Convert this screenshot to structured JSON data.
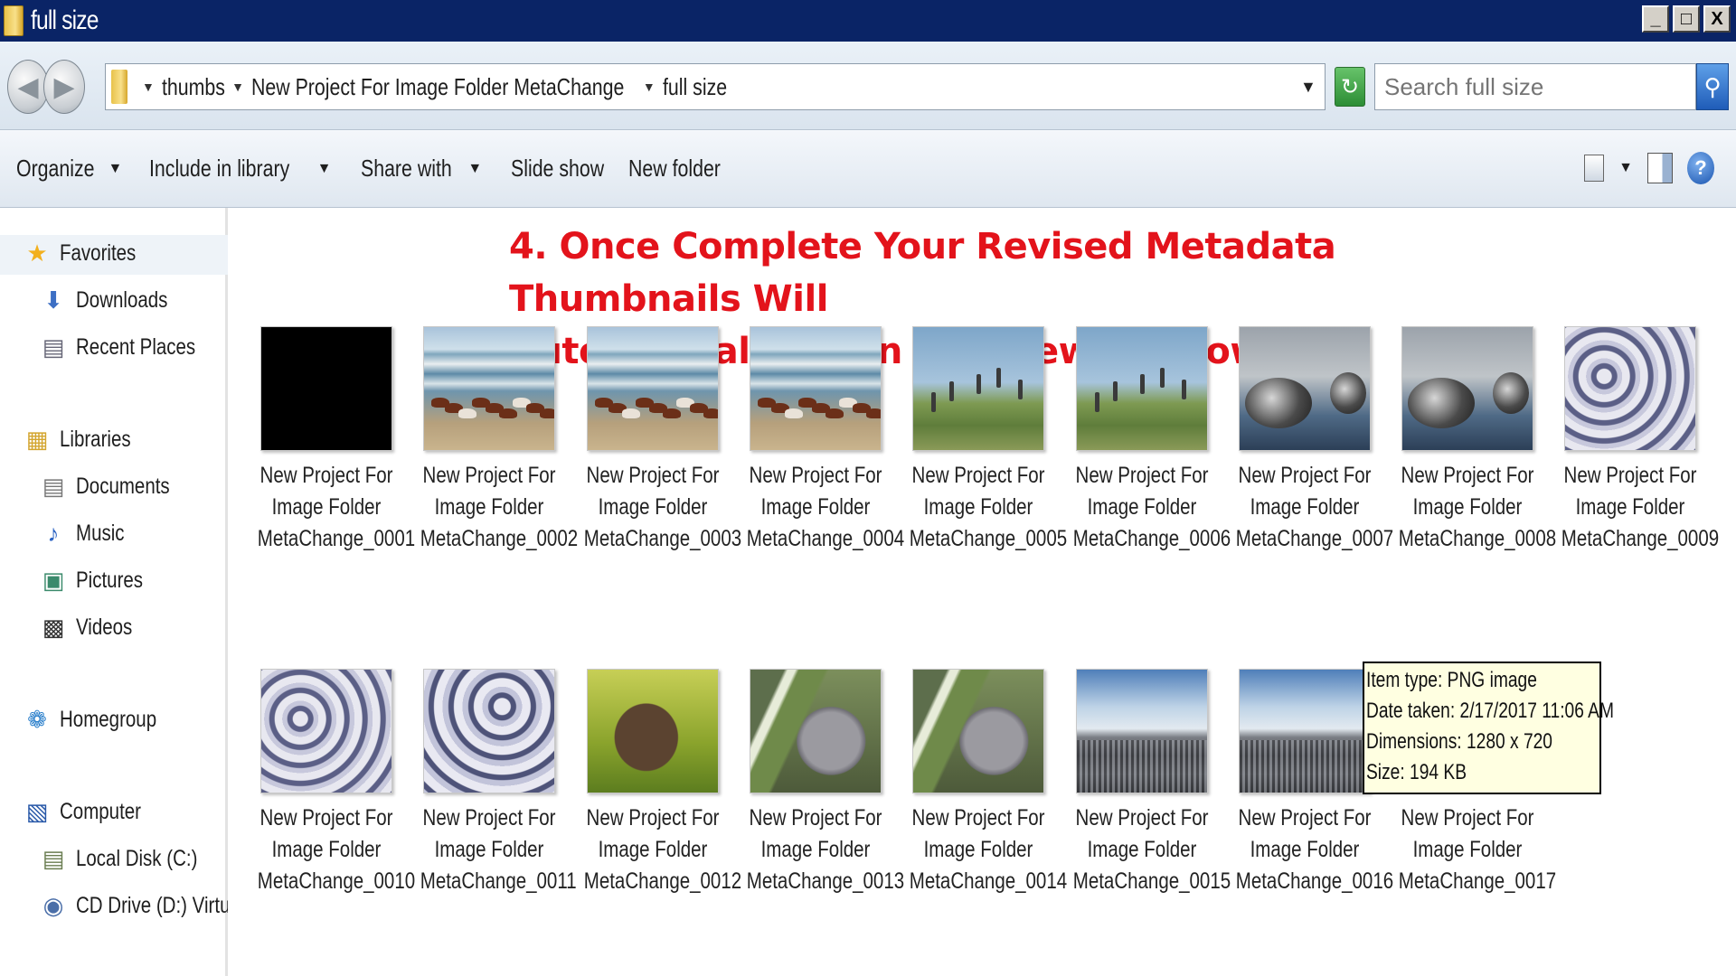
{
  "window": {
    "title": "full size",
    "controls": [
      "_",
      "□",
      "X"
    ]
  },
  "address": {
    "breadcrumbs": [
      "thumbs",
      "New Project For Image Folder MetaChange",
      "full size"
    ],
    "search_placeholder": "Search full size"
  },
  "toolbar": {
    "organize": "Organize",
    "include_in_library": "Include in library",
    "share_with": "Share with",
    "slide_show": "Slide show",
    "new_folder": "New folder"
  },
  "sidebar": {
    "favorites": "Favorites",
    "downloads": "Downloads",
    "recent_places": "Recent Places",
    "libraries": "Libraries",
    "documents": "Documents",
    "music": "Music",
    "pictures": "Pictures",
    "videos": "Videos",
    "homegroup": "Homegroup",
    "computer": "Computer",
    "local_disk": "Local Disk (C:)",
    "cd_drive": "CD Drive (D:) VirtualBo"
  },
  "annotation": {
    "line1": "4. Once Complete Your Revised Metadata Thumbnails Will",
    "line2": "Automatically Open In A New Window"
  },
  "caption_prefix": {
    "line1": "New Project For",
    "line2": "Image Folder"
  },
  "files": [
    {
      "line3": "MetaChange_0001",
      "art": "black"
    },
    {
      "line3": "MetaChange_0002",
      "art": "horse"
    },
    {
      "line3": "MetaChange_0003",
      "art": "horse"
    },
    {
      "line3": "MetaChange_0004",
      "art": "horse"
    },
    {
      "line3": "MetaChange_0005",
      "art": "birds"
    },
    {
      "line3": "MetaChange_0006",
      "art": "birds"
    },
    {
      "line3": "MetaChange_0007",
      "art": "seal"
    },
    {
      "line3": "MetaChange_0008",
      "art": "seal"
    },
    {
      "line3": "MetaChange_0009",
      "art": "flock"
    },
    {
      "line3": "MetaChange_0010",
      "art": "flock"
    },
    {
      "line3": "MetaChange_0011",
      "art": "flock2"
    },
    {
      "line3": "MetaChange_0012",
      "art": "hyrax"
    },
    {
      "line3": "MetaChange_0013",
      "art": "koala"
    },
    {
      "line3": "MetaChange_0014",
      "art": "koala"
    },
    {
      "line3": "MetaChange_0015",
      "art": "penguin"
    },
    {
      "line3": "MetaChange_0016",
      "art": "penguin"
    },
    {
      "line3": "MetaChange_0017",
      "art": "none"
    }
  ],
  "tooltip": {
    "item_type": "Item type: PNG image",
    "date_taken": "Date taken: 2/17/2017 11:06 AM",
    "dimensions": "Dimensions: 1280 x 720",
    "size": "Size: 194 KB"
  }
}
